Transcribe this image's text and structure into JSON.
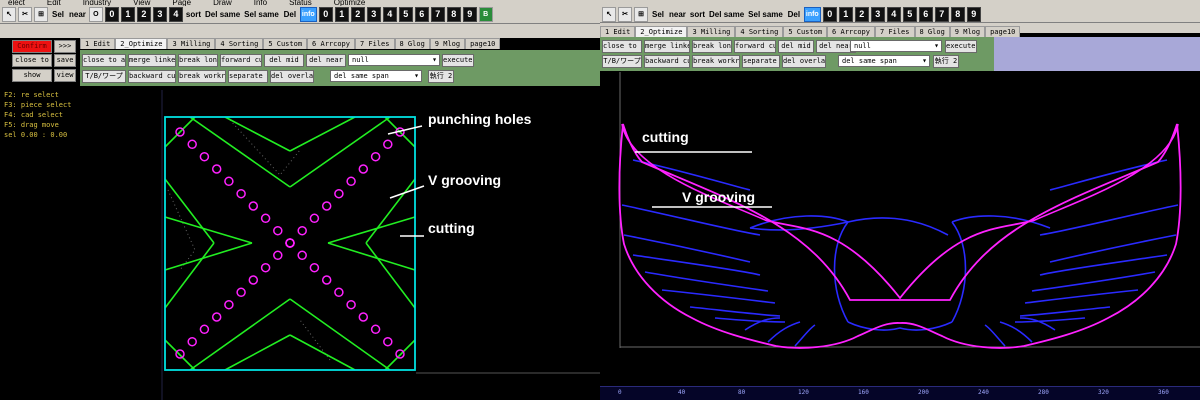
{
  "left": {
    "menu": [
      "elect",
      "Edit",
      "Industry",
      "View",
      "Page",
      "Draw",
      "Info",
      "Status",
      "Optimize"
    ],
    "toolbar": [
      "↖",
      "✂",
      "⊞",
      "Sel",
      "near",
      "O",
      "0",
      "1",
      "2",
      "3",
      "4",
      "sort",
      "Del same",
      "Sel same",
      "Del",
      "info",
      "0",
      "1",
      "2",
      "3",
      "4",
      "5",
      "6",
      "7",
      "8",
      "9",
      "B"
    ],
    "side_buttons": {
      "red": "Confirm",
      "arrows": ">>>",
      "close": "close to axis",
      "show": "show reminder",
      "save": "save",
      "view": "view"
    },
    "tabs": [
      "1 Edit",
      "2_Optimize",
      "3 Milling",
      "4 Sorting",
      "5 Custom",
      "6 Arrcopy",
      "7 Files",
      "8 Glog",
      "9 Mlog",
      "page10"
    ],
    "options": {
      "row1": [
        "close to axis",
        "merge linked",
        "break long",
        "forward cut",
        "del mid",
        "del near"
      ],
      "select1": "null",
      "exec1": "execute 2",
      "row2": [
        "T/B/ワープ",
        "backward cut",
        "break workrect",
        "separate all",
        "del overlap"
      ],
      "select2": "del same span",
      "exec2": "執行 2"
    },
    "status": [
      "F2: re select",
      "F3: piece select",
      "F4: cad select",
      "F5: drag move",
      "sel 0.00 : 0.00"
    ],
    "callouts": {
      "punching": "punching holes",
      "vgroove": "V grooving",
      "cutting": "cutting"
    }
  },
  "right": {
    "toolbar": [
      "↖",
      "✂",
      "⊞",
      "Sel",
      "near",
      "sort",
      "Del same",
      "Sel same",
      "Del",
      "info",
      "0",
      "1",
      "2",
      "3",
      "4",
      "5",
      "6",
      "7",
      "8",
      "9"
    ],
    "tabs": [
      "1 Edit",
      "2_Optimize",
      "3 Milling",
      "4 Sorting",
      "5 Custom",
      "6 Arrcopy",
      "7 Files",
      "8 Glog",
      "9 Mlog",
      "page10"
    ],
    "options": {
      "row1": [
        "close to axis",
        "merge linked",
        "break long",
        "forward cut",
        "del mid",
        "del near"
      ],
      "select1": "null",
      "exec1": "execute 2",
      "row2": [
        "T/B/ワープ",
        "backward cut",
        "break workrect",
        "separate all",
        "del overlap"
      ],
      "select2": "del same span",
      "exec2": "執行 2"
    },
    "callouts": {
      "cutting": "cutting",
      "vgroove": "V grooving"
    },
    "ruler": [
      "0",
      "40",
      "80",
      "120",
      "160",
      "200",
      "240",
      "280",
      "320",
      "360"
    ]
  },
  "colors": {
    "cyan": "#00e0e0",
    "green": "#22ee22",
    "magenta": "#ff22ff",
    "blue": "#2a2aff",
    "white": "#ffffff",
    "toolbar": "#d4d0c8",
    "options": "#6e9a64"
  }
}
